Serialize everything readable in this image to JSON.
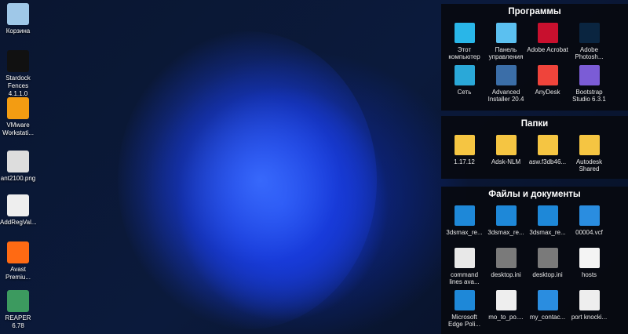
{
  "desktop": [
    {
      "label": "Корзина",
      "icon": "recycle-bin-icon",
      "color": "#9fc8e8"
    },
    {
      "label": "Stardock Fences 4.1.1.0",
      "icon": "fences-icon",
      "color": "#111"
    },
    {
      "label": "VMware Workstati...",
      "icon": "vmware-icon",
      "color": "#f39c12"
    },
    {
      "label": "ant2100.png",
      "icon": "image-file-icon",
      "color": "#ddd"
    },
    {
      "label": "AddRegVal...",
      "icon": "script-file-icon",
      "color": "#eee"
    },
    {
      "label": "Avast Premiu...",
      "icon": "avast-icon",
      "color": "#ff6a13"
    },
    {
      "label": "REAPER 6.78",
      "icon": "reaper-icon",
      "color": "#3c9a5f"
    }
  ],
  "fences": [
    {
      "title": "Программы",
      "items": [
        {
          "label": "Этот компьютер",
          "icon": "computer-icon",
          "color": "#29b6e8"
        },
        {
          "label": "Панель управления",
          "icon": "control-panel-icon",
          "color": "#5bc0f0"
        },
        {
          "label": "Adobe Acrobat",
          "icon": "acrobat-icon",
          "color": "#c8102e"
        },
        {
          "label": "Adobe Photosh...",
          "icon": "photoshop-icon",
          "color": "#0a2540"
        },
        {
          "label": "Сеть",
          "icon": "network-icon",
          "color": "#2aa8d8"
        },
        {
          "label": "Advanced Installer 20.4",
          "icon": "advanced-installer-icon",
          "color": "#3b6ea8"
        },
        {
          "label": "AnyDesk",
          "icon": "anydesk-icon",
          "color": "#ef443b"
        },
        {
          "label": "Bootstrap Studio 6.3.1",
          "icon": "bootstrap-studio-icon",
          "color": "#7b5cd6"
        }
      ]
    },
    {
      "title": "Папки",
      "items": [
        {
          "label": "1.17.12",
          "icon": "folder-icon",
          "color": "#f5c542"
        },
        {
          "label": "Adsk-NLM",
          "icon": "folder-icon",
          "color": "#f5c542"
        },
        {
          "label": "asw.f3db46...",
          "icon": "folder-icon",
          "color": "#f5c542"
        },
        {
          "label": "Autodesk Shared",
          "icon": "folder-icon",
          "color": "#f5c542"
        }
      ]
    },
    {
      "title": "Файлы и документы",
      "items": [
        {
          "label": "3dsmax_re...",
          "icon": "registry-file-icon",
          "color": "#1e88d8"
        },
        {
          "label": "3dsmax_re...",
          "icon": "registry-file-icon",
          "color": "#1e88d8"
        },
        {
          "label": "3dsmax_re...",
          "icon": "registry-file-icon",
          "color": "#1e88d8"
        },
        {
          "label": "00004.vcf",
          "icon": "contact-icon",
          "color": "#2a8de0"
        },
        {
          "label": "command lines ava...",
          "icon": "text-file-icon",
          "color": "#e8e8e8"
        },
        {
          "label": "desktop.ini",
          "icon": "ini-file-icon",
          "color": "#7a7a7a"
        },
        {
          "label": "desktop.ini",
          "icon": "ini-file-icon",
          "color": "#7a7a7a"
        },
        {
          "label": "hosts",
          "icon": "file-icon",
          "color": "#f4f4f4"
        },
        {
          "label": "Microsoft Edge Poli...",
          "icon": "registry-file-icon",
          "color": "#1e88d8"
        },
        {
          "label": "mo_to_po....",
          "icon": "script-file-icon",
          "color": "#eee"
        },
        {
          "label": "my_contac...",
          "icon": "contact-icon",
          "color": "#2a8de0"
        },
        {
          "label": "port knocki...",
          "icon": "script-file-icon",
          "color": "#eee"
        }
      ]
    }
  ]
}
